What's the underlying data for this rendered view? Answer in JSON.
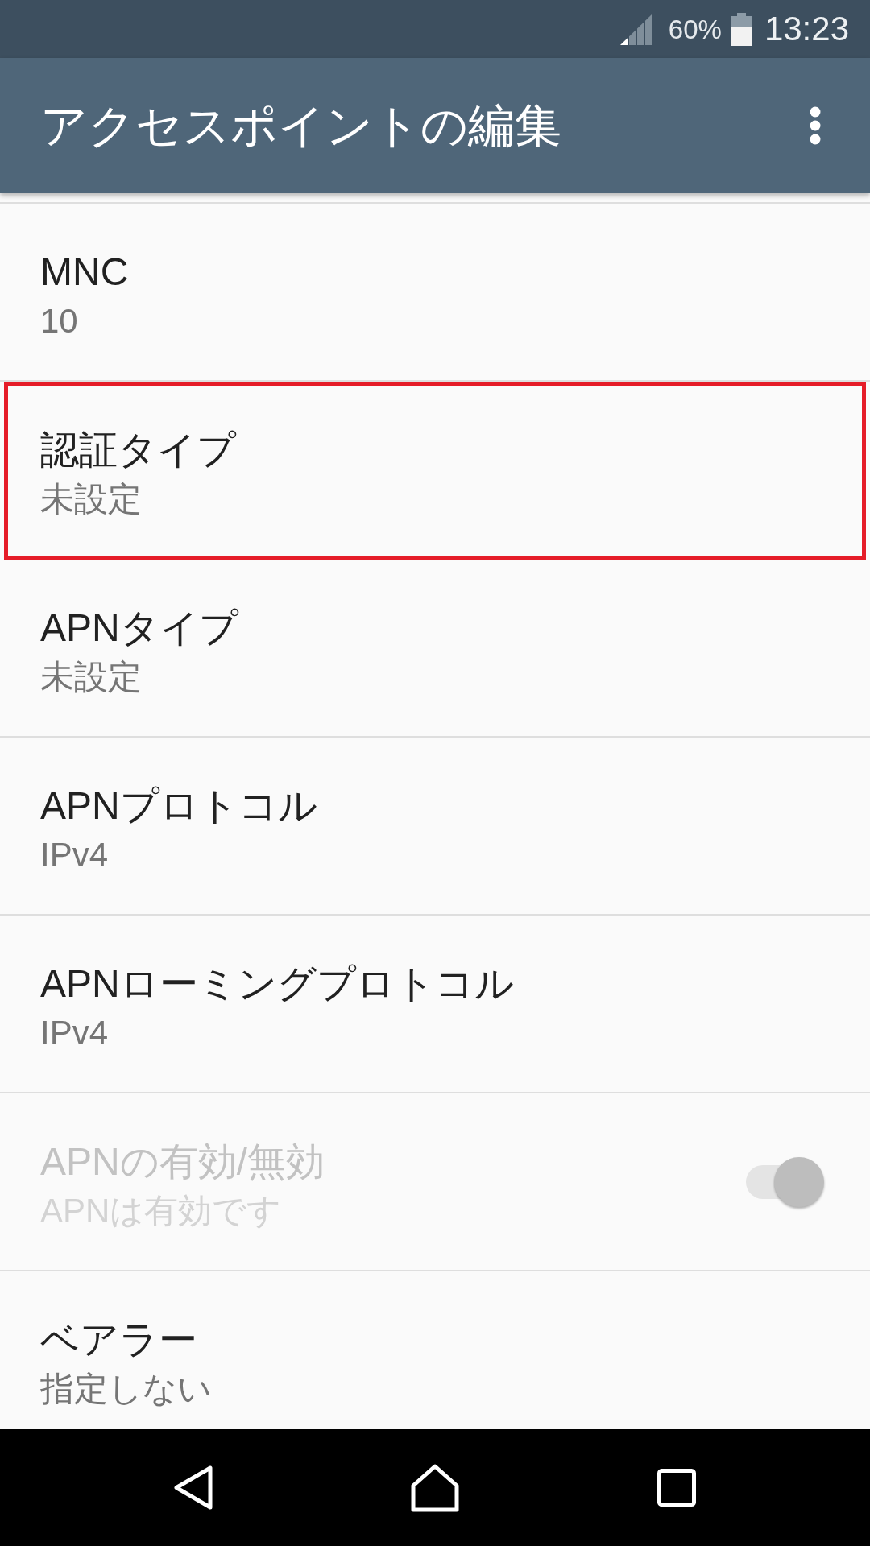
{
  "status_bar": {
    "battery_percent": "60%",
    "time": "13:23"
  },
  "app_bar": {
    "title": "アクセスポイントの編集"
  },
  "rows": [
    {
      "kind": "text",
      "title": "MNC",
      "value": "10",
      "disabled": false,
      "highlighted": false
    },
    {
      "kind": "text",
      "title": "認証タイプ",
      "value": "未設定",
      "disabled": false,
      "highlighted": true
    },
    {
      "kind": "text",
      "title": "APNタイプ",
      "value": "未設定",
      "disabled": false,
      "highlighted": false
    },
    {
      "kind": "text",
      "title": "APNプロトコル",
      "value": "IPv4",
      "disabled": false,
      "highlighted": false
    },
    {
      "kind": "text",
      "title": "APNローミングプロトコル",
      "value": "IPv4",
      "disabled": false,
      "highlighted": false
    },
    {
      "kind": "switch",
      "title": "APNの有効/無効",
      "value": "APNは有効です",
      "disabled": true,
      "highlighted": false,
      "on": true
    },
    {
      "kind": "text",
      "title": "ベアラー",
      "value": "指定しない",
      "disabled": false,
      "highlighted": false
    }
  ]
}
